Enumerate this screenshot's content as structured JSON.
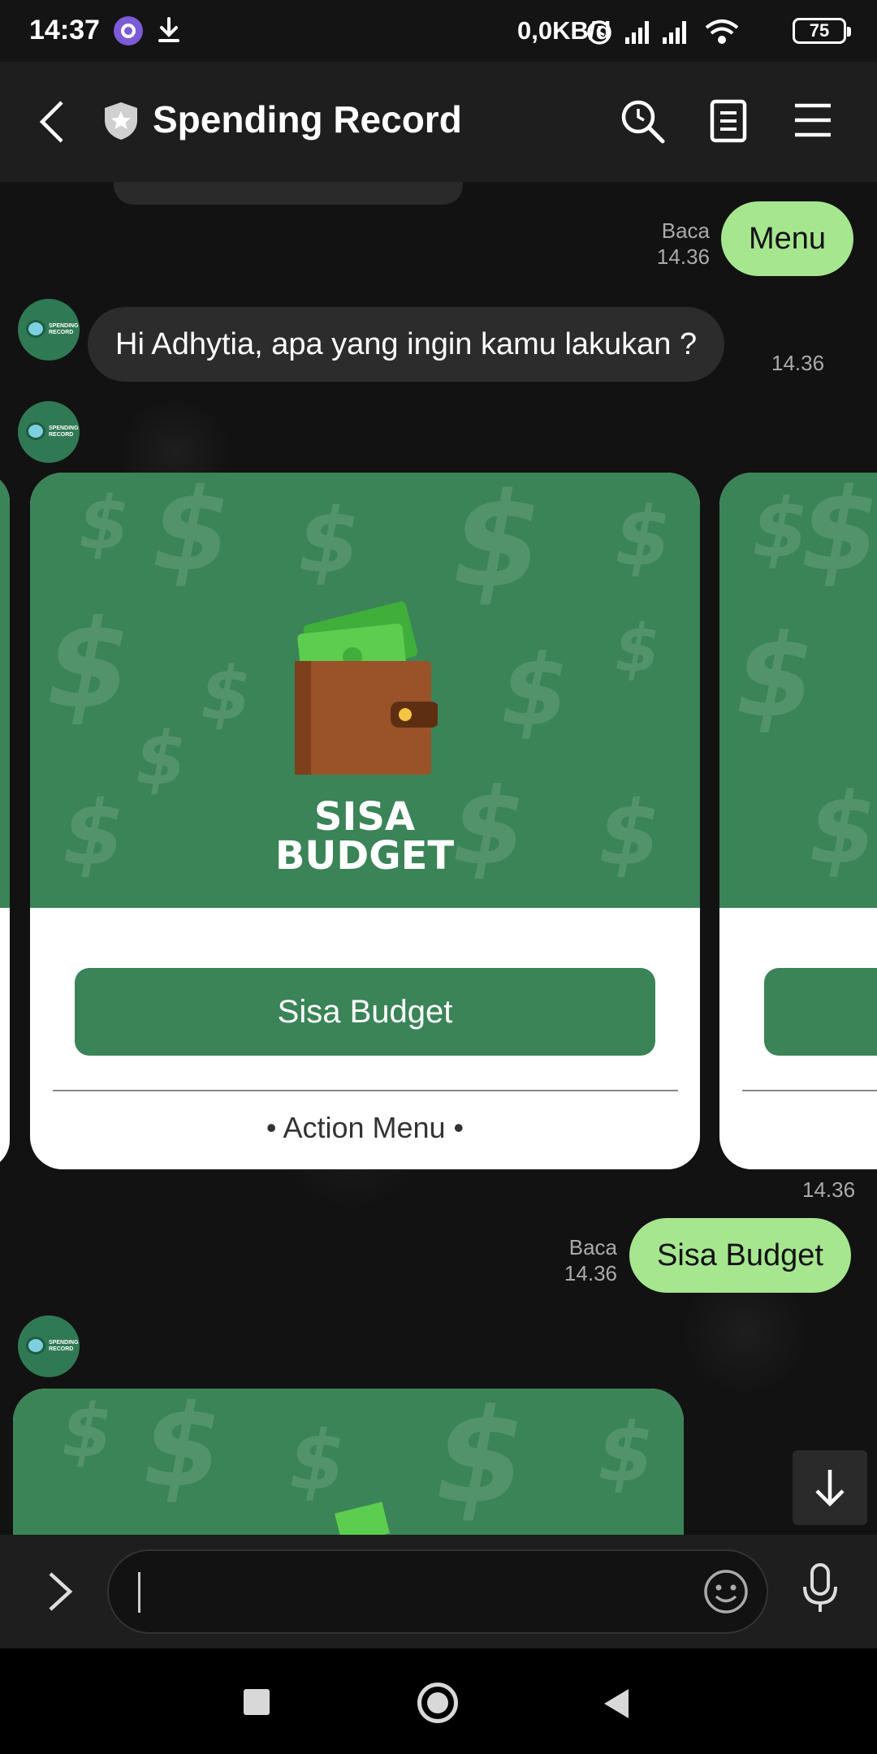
{
  "status_bar": {
    "time": "14:37",
    "network_speed": "0,0KB/d",
    "battery": "75"
  },
  "header": {
    "title": "Spending Record",
    "icons": [
      "back-arrow-icon",
      "shield-star-icon",
      "search-clock-icon",
      "notes-icon",
      "hamburger-menu-icon"
    ]
  },
  "messages": {
    "outgoing_1": {
      "text": "Menu",
      "status": "Baca",
      "time": "14.36"
    },
    "incoming_1": {
      "text": "Hi Adhytia, apa yang ingin kamu lakukan ?",
      "time": "14.36"
    },
    "carousel": {
      "time": "14.36",
      "card": {
        "image_title_line1": "SISA",
        "image_title_line2": "BUDGET",
        "button_label": "Sisa Budget",
        "footer": "• Action Menu •"
      }
    },
    "outgoing_2": {
      "text": "Sisa Budget",
      "status": "Baca",
      "time": "14.36"
    },
    "bot_avatar_label": "SPENDING RECORD"
  },
  "colors": {
    "accent_green": "#3a8457",
    "outgoing_bubble": "#a6e68f",
    "incoming_bubble": "#2c2c2c",
    "header_bg": "#1e1e1e"
  },
  "input": {
    "placeholder": ""
  }
}
